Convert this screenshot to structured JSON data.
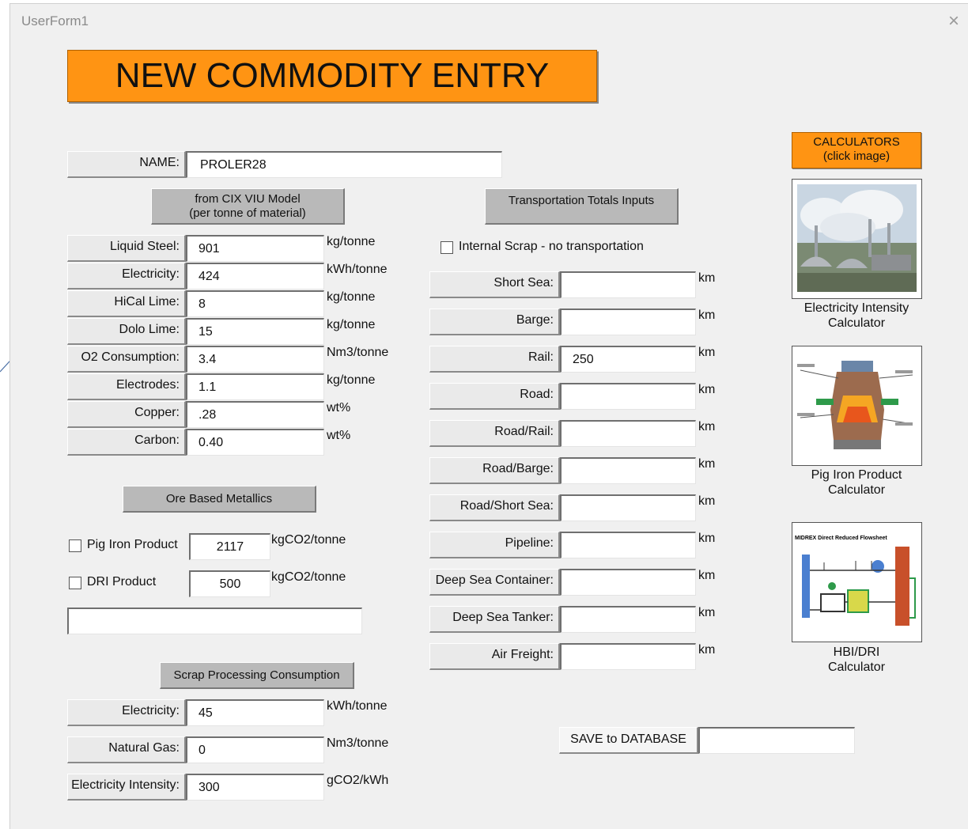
{
  "window": {
    "title": "UserForm1",
    "close_icon": "×"
  },
  "banner": "NEW COMMODITY ENTRY",
  "name_label": "NAME:",
  "name_value": "PROLER28",
  "viu_button": [
    "from CIX VIU Model",
    "(per tonne of material)"
  ],
  "viu_fields": [
    {
      "label": "Liquid Steel:",
      "value": "901",
      "unit": "kg/tonne"
    },
    {
      "label": "Electricity:",
      "value": "424",
      "unit": "kWh/tonne"
    },
    {
      "label": "HiCal Lime:",
      "value": "8",
      "unit": "kg/tonne"
    },
    {
      "label": "Dolo Lime:",
      "value": "15",
      "unit": "kg/tonne"
    },
    {
      "label": "O2 Consumption:",
      "value": "3.4",
      "unit": "Nm3/tonne"
    },
    {
      "label": "Electrodes:",
      "value": "1.1",
      "unit": "kg/tonne"
    },
    {
      "label": "Copper:",
      "value": ".28",
      "unit": "wt%"
    },
    {
      "label": "Carbon:",
      "value": "0.40",
      "unit": "wt%"
    }
  ],
  "ore_button": "Ore Based Metallics",
  "ore_items": [
    {
      "label": "Pig Iron Product",
      "value": "2117",
      "unit": "kgCO2/tonne",
      "checked": false
    },
    {
      "label": "DRI Product",
      "value": "500",
      "unit": "kgCO2/tonne",
      "checked": false
    }
  ],
  "scrap_button": "Scrap Processing Consumption",
  "scrap_fields": [
    {
      "label": "Electricity:",
      "value": "45",
      "unit": "kWh/tonne"
    },
    {
      "label": "Natural Gas:",
      "value": "0",
      "unit": "Nm3/tonne"
    },
    {
      "label": "Electricity Intensity:",
      "value": "300",
      "unit": "gCO2/kWh"
    }
  ],
  "transport_button": "Transportation Totals Inputs",
  "internal_scrap_label": "Internal Scrap - no transportation",
  "transport_fields": [
    {
      "label": "Short Sea:",
      "value": "",
      "unit": "km"
    },
    {
      "label": "Barge:",
      "value": "",
      "unit": "km"
    },
    {
      "label": "Rail:",
      "value": "250",
      "unit": "km"
    },
    {
      "label": "Road:",
      "value": "",
      "unit": "km"
    },
    {
      "label": "Road/Rail:",
      "value": "",
      "unit": "km"
    },
    {
      "label": "Road/Barge:",
      "value": "",
      "unit": "km"
    },
    {
      "label": "Road/Short Sea:",
      "value": "",
      "unit": "km"
    },
    {
      "label": "Pipeline:",
      "value": "",
      "unit": "km"
    },
    {
      "label": "Deep Sea Container:",
      "value": "",
      "unit": "km"
    },
    {
      "label": "Deep Sea Tanker:",
      "value": "",
      "unit": "km"
    },
    {
      "label": "Air Freight:",
      "value": "",
      "unit": "km"
    }
  ],
  "save_button": "SAVE to DATABASE",
  "calculators_button": [
    "CALCULATORS",
    "(click image)"
  ],
  "calculators": [
    {
      "caption": [
        "Electricity Intensity",
        "Calculator"
      ]
    },
    {
      "caption": [
        "Pig Iron Product",
        "Calculator"
      ]
    },
    {
      "caption": [
        "HBI/DRI",
        "Calculator"
      ],
      "image_text": "MIDREX Direct Reduced Flowsheet"
    }
  ],
  "colors": {
    "orange": "#ff9413",
    "form_bg": "#f0f0f0",
    "bracket": "#4a6fa5"
  }
}
